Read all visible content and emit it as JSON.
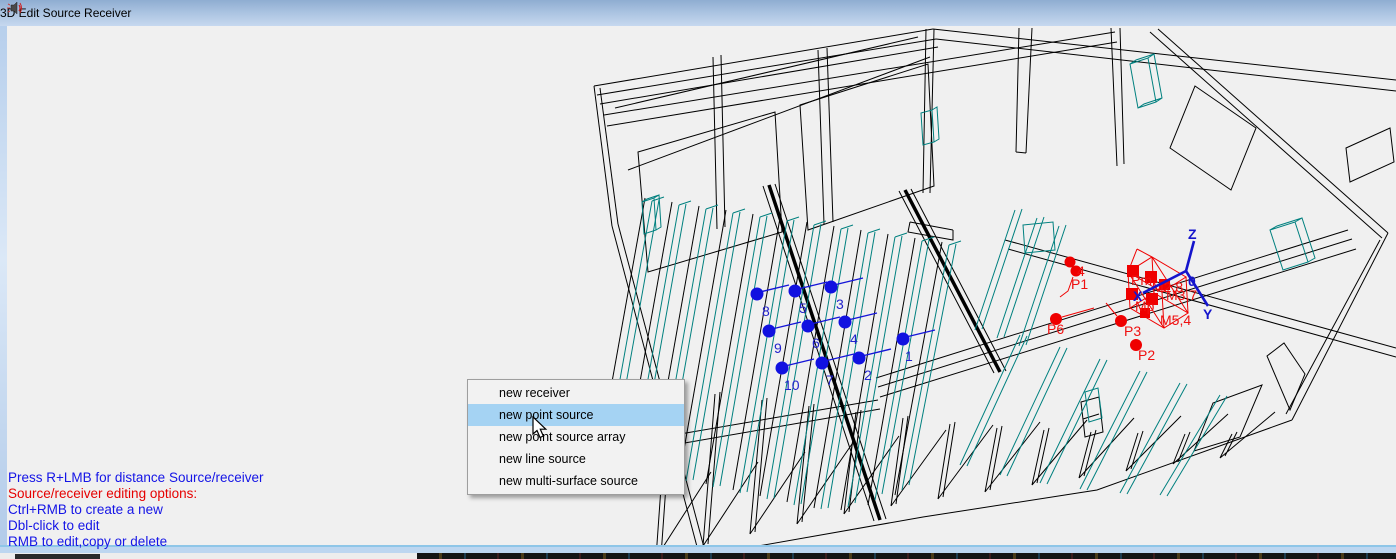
{
  "window": {
    "title": "3D Edit Source Receiver",
    "icon": "speaker-icon",
    "titlebar_color": "#a9c2e0",
    "client_background": "#f0f0f0"
  },
  "context_menu": {
    "background": "#f2f2f2",
    "highlight_color": "#a5d3f3",
    "items": [
      {
        "label": "new receiver",
        "highlighted": false
      },
      {
        "label": "new point source",
        "highlighted": true
      },
      {
        "label": "new point source array",
        "highlighted": false
      },
      {
        "label": "new line source",
        "highlighted": false
      },
      {
        "label": "new multi-surface source",
        "highlighted": false
      }
    ]
  },
  "instructions": {
    "lines": [
      {
        "text": "Press R+LMB for distance Source/receiver",
        "color": "blue"
      },
      {
        "text": "Source/receiver editing options:",
        "color": "red"
      },
      {
        "text": "Ctrl+RMB to create a new",
        "color": "blue"
      },
      {
        "text": "Dbl-click to edit",
        "color": "blue"
      },
      {
        "text": "RMB to edit,copy or delete",
        "color": "blue"
      }
    ]
  },
  "viewport": {
    "wireframe_colors": {
      "structure": "#000000",
      "seating": "#00807f",
      "sources": "#ef0000",
      "receivers": "#1111e0"
    },
    "receivers": [
      {
        "label": "1"
      },
      {
        "label": "2"
      },
      {
        "label": "3"
      },
      {
        "label": "4"
      },
      {
        "label": "5"
      },
      {
        "label": "6"
      },
      {
        "label": "7"
      },
      {
        "label": "8"
      },
      {
        "label": "9"
      },
      {
        "label": "10"
      }
    ],
    "point_sources": [
      {
        "label": "4"
      },
      {
        "label": "P1"
      },
      {
        "label": "P2"
      },
      {
        "label": "P3"
      },
      {
        "label": "P6"
      }
    ],
    "cluster_sources": [
      {
        "label": "Pm"
      },
      {
        "label": "M2,8"
      },
      {
        "label": "M3,7"
      },
      {
        "label": "Mp"
      },
      {
        "label": "M5,4"
      }
    ],
    "axis": {
      "z_label": "Z",
      "y_label": "Y",
      "x_label": "X",
      "origin_label": "0"
    }
  }
}
